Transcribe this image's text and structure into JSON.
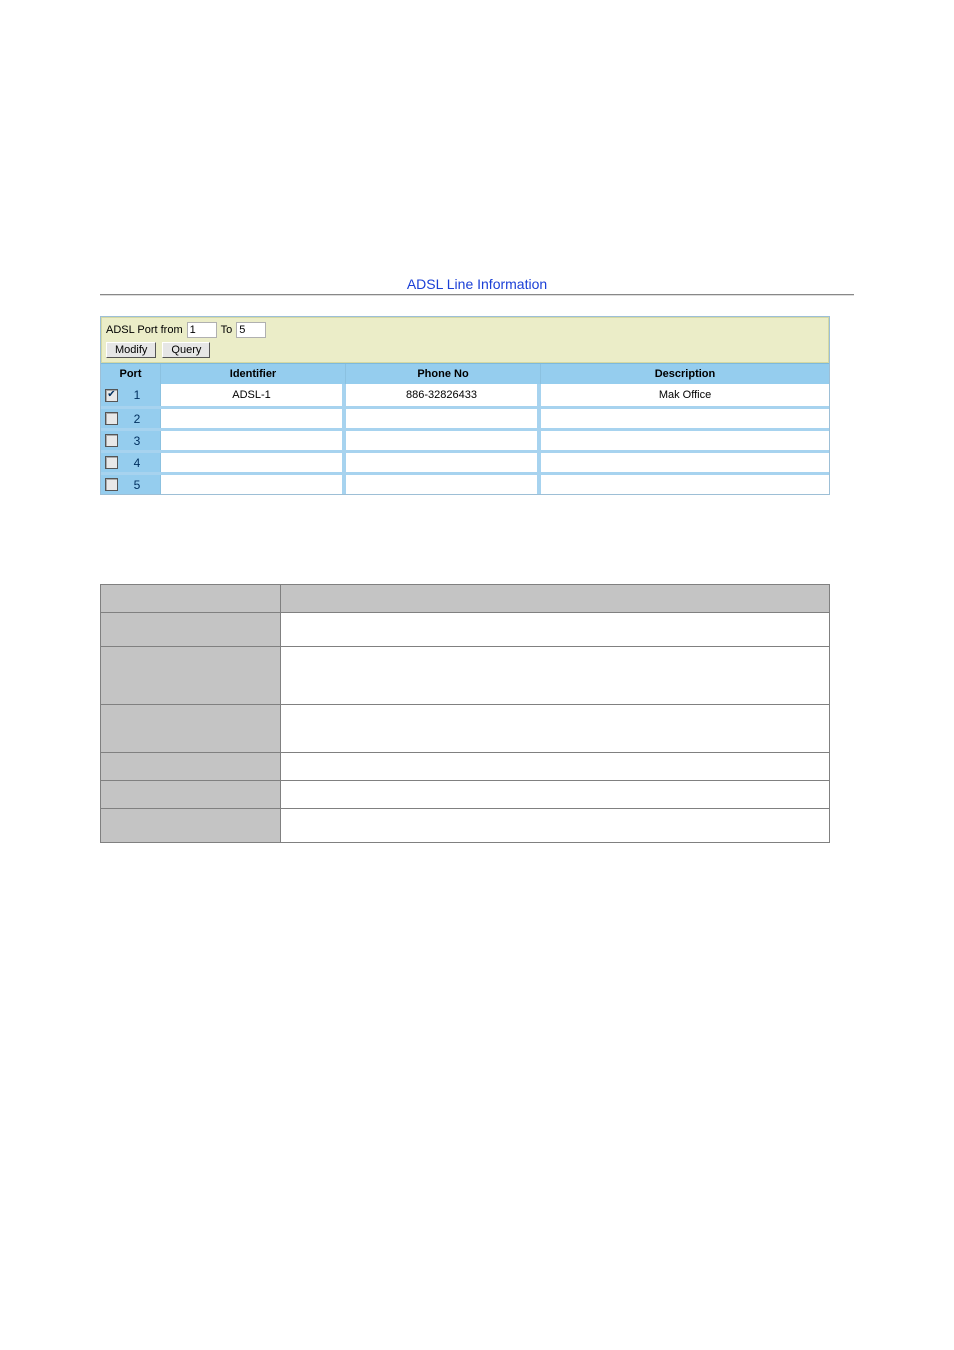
{
  "title": "ADSL Line Information",
  "filter": {
    "label_from": "ADSL Port from",
    "from_value": "1",
    "label_to": "To",
    "to_value": "5",
    "btn_modify": "Modify",
    "btn_query": "Query"
  },
  "columns": {
    "port": "Port",
    "identifier": "Identifier",
    "phone": "Phone No",
    "description": "Description"
  },
  "rows": [
    {
      "checked": true,
      "port": "1",
      "identifier": "ADSL-1",
      "phone": "886-32826433",
      "description": "Mak Office"
    },
    {
      "checked": false,
      "port": "2",
      "identifier": "",
      "phone": "",
      "description": ""
    },
    {
      "checked": false,
      "port": "3",
      "identifier": "",
      "phone": "",
      "description": ""
    },
    {
      "checked": false,
      "port": "4",
      "identifier": "",
      "phone": "",
      "description": ""
    },
    {
      "checked": false,
      "port": "5",
      "identifier": "",
      "phone": "",
      "description": ""
    }
  ],
  "lower_rows": [
    {
      "h": "lh-28",
      "label": "",
      "value": ""
    },
    {
      "h": "lh-34",
      "label": "",
      "value": ""
    },
    {
      "h": "lh-58",
      "label": "",
      "value": ""
    },
    {
      "h": "lh-48",
      "label": "",
      "value": ""
    },
    {
      "h": "lh-28",
      "label": "",
      "value": ""
    },
    {
      "h": "lh-28",
      "label": "",
      "value": ""
    },
    {
      "h": "lh-34",
      "label": "",
      "value": ""
    }
  ]
}
